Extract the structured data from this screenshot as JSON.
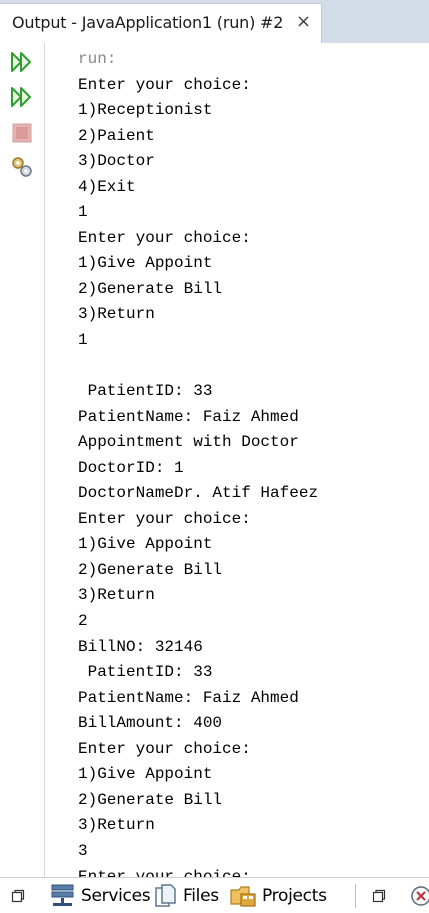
{
  "window": {
    "tab_title": "Output - JavaApplication1 (run) #2",
    "close_glyph": "×"
  },
  "toolbar": {
    "buttons": [
      {
        "name": "rerun-icon",
        "color": "#2e9e2e"
      },
      {
        "name": "rerun-with-params-icon",
        "color": "#2e9e2e"
      },
      {
        "name": "stop-icon",
        "color": "#d89a9a"
      },
      {
        "name": "settings-icon",
        "color": "#b08a3a"
      }
    ]
  },
  "console": {
    "lines": [
      "run:",
      "Enter your choice:",
      "1)Receptionist",
      "2)Paient",
      "3)Doctor",
      "4)Exit",
      "1",
      "Enter your choice:",
      "1)Give Appoint",
      "2)Generate Bill",
      "3)Return",
      "1",
      "",
      " PatientID: 33",
      "PatientName: Faiz Ahmed",
      "Appointment with Doctor",
      "DoctorID: 1",
      "DoctorNameDr. Atif Hafeez",
      "Enter your choice:",
      "1)Give Appoint",
      "2)Generate Bill",
      "3)Return",
      "2",
      "BillNO: 32146",
      " PatientID: 33",
      "PatientName: Faiz Ahmed",
      "BillAmount: 400",
      "Enter your choice:",
      "1)Give Appoint",
      "2)Generate Bill",
      "3)Return",
      "3",
      "Enter your choice:"
    ]
  },
  "bottombar": {
    "services_label": "Services",
    "files_label": "Files",
    "projects_label": "Projects"
  }
}
